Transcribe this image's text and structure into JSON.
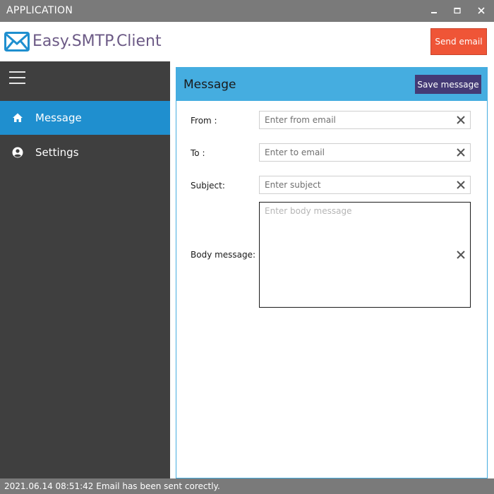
{
  "window": {
    "title": "APPLICATION",
    "controls": {
      "minimize_icon": "minimize-icon",
      "maximize_icon": "maximize-icon",
      "close_icon": "close-icon"
    }
  },
  "header": {
    "logo_icon": "envelope-icon",
    "app_title": "Easy.SMTP.Client",
    "send_button_label": "Send email",
    "colors": {
      "title": "#6c5a86",
      "send_button": "#ef5537",
      "logo": "#1f8fcf"
    }
  },
  "sidebar": {
    "menu_icon": "hamburger-menu-icon",
    "items": [
      {
        "label": "Message",
        "icon": "home-icon",
        "active": true
      },
      {
        "label": "Settings",
        "icon": "user-account-icon",
        "active": false
      }
    ],
    "colors": {
      "background": "#3f3f3f",
      "active": "#1f8fcf"
    }
  },
  "panel": {
    "title": "Message",
    "save_button_label": "Save message",
    "colors": {
      "header": "#45ade0",
      "save_button": "#443a75"
    },
    "fields": {
      "from": {
        "label": "From :",
        "value": "",
        "placeholder": "Enter from email"
      },
      "to": {
        "label": "To :",
        "value": "",
        "placeholder": "Enter to email"
      },
      "subject": {
        "label": "Subject:",
        "value": "",
        "placeholder": "Enter subject"
      },
      "body": {
        "label": "Body message:",
        "value": "",
        "placeholder": "Enter body message"
      }
    }
  },
  "status": {
    "text": "2021.06.14 08:51:42 Email has been sent corectly."
  }
}
